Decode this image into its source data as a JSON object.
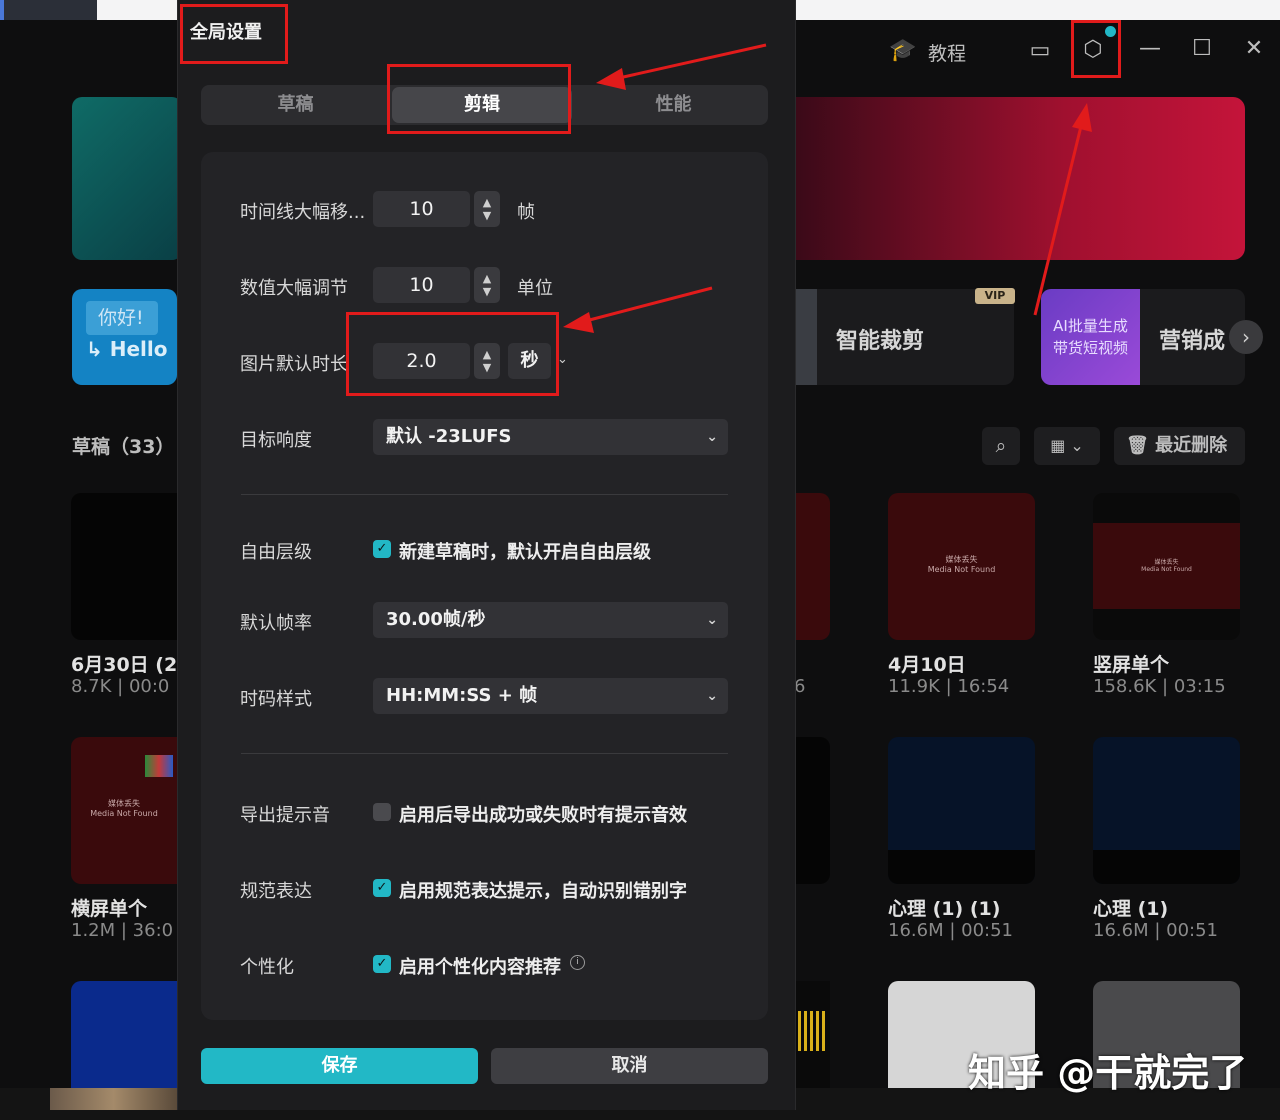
{
  "dialog": {
    "title": "全局设置",
    "tabs": [
      {
        "label": "草稿",
        "active": false
      },
      {
        "label": "剪辑",
        "active": true
      },
      {
        "label": "性能",
        "active": false
      }
    ],
    "rows": {
      "timeline_jump": {
        "label": "时间线大幅移...",
        "value": "10",
        "unit": "帧"
      },
      "value_adjust": {
        "label": "数值大幅调节",
        "value": "10",
        "unit": "单位"
      },
      "image_duration": {
        "label": "图片默认时长",
        "value": "2.0",
        "unit": "秒"
      },
      "loudness": {
        "label": "目标响度",
        "value": "默认 -23LUFS"
      },
      "free_layer": {
        "label": "自由层级",
        "checkbox_text": "新建草稿时，默认开启自由层级",
        "checked": true
      },
      "frame_rate": {
        "label": "默认帧率",
        "value": "30.00帧/秒"
      },
      "timecode": {
        "label": "时码样式",
        "value": "HH:MM:SS + 帧"
      },
      "export_sound": {
        "label": "导出提示音",
        "checkbox_text": "启用后导出成功或失败时有提示音效",
        "checked": false
      },
      "normalize": {
        "label": "规范表达",
        "checkbox_text": "启用规范表达提示，自动识别错别字",
        "checked": true
      },
      "personalize": {
        "label": "个性化",
        "checkbox_text": "启用个性化内容推荐",
        "checked": true
      }
    },
    "save_label": "保存",
    "cancel_label": "取消"
  },
  "background": {
    "header": {
      "tutorial_label": "教程"
    },
    "tools": {
      "hello_badge_1": "你好!",
      "hello_badge_2": "Hello",
      "smart_cut": "智能裁剪",
      "vip_badge": "VIP",
      "ai_label": "AI批量生成\n带货短视频",
      "marketing": "营销成"
    },
    "drafts_title": "草稿（33）",
    "recent_delete": "最近删除",
    "media_lost_cn": "媒体丢失",
    "media_lost_en": "Media Not Found",
    "cards": [
      {
        "title": "6月30日 (2)",
        "meta": "8.7K | 00:0"
      },
      {
        "title": "4月10日",
        "meta": "11.9K | 16:54"
      },
      {
        "title": "竖屏单个",
        "meta": "158.6K | 03:15"
      },
      {
        "title": "横屏单个",
        "meta": "1.2M | 36:0"
      },
      {
        "title": "心理 (1) (1)",
        "meta": "16.6M | 00:51"
      },
      {
        "title": "心理 (1)",
        "meta": "16.6M | 00:51"
      }
    ],
    "partial_meta_digit": "6"
  },
  "watermark": "知乎 @干就完了",
  "colors": {
    "accent": "#22b8c6",
    "annotation": "#e11b1b",
    "banner_red": "#a0102f"
  }
}
